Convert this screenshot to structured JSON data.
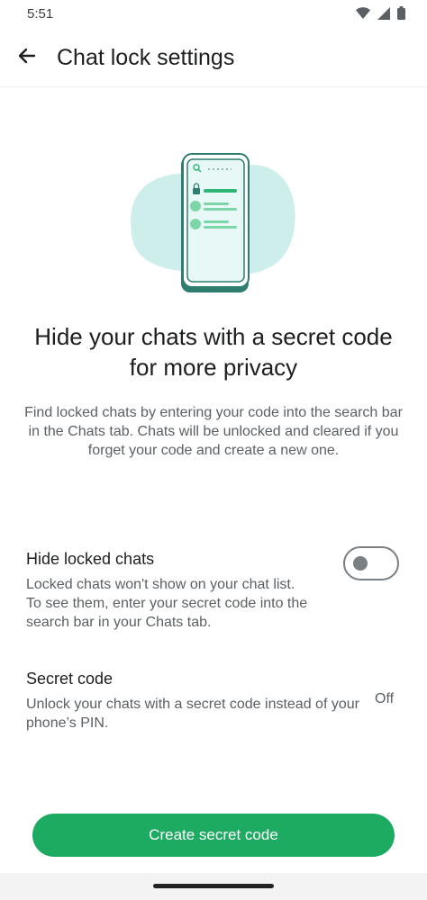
{
  "status_bar": {
    "time": "5:51",
    "icons": [
      "wifi-icon",
      "signal-icon",
      "battery-icon"
    ]
  },
  "app_bar": {
    "back_icon": "arrow-left-icon",
    "title": "Chat lock settings"
  },
  "illustration": {
    "icons": [
      "search-icon",
      "lock-icon"
    ]
  },
  "intro": {
    "headline": "Hide your chats with a secret code for more privacy",
    "description": "Find locked chats by entering your code into the search bar in the Chats tab. Chats will be unlocked and cleared if you forget your code and create a new one."
  },
  "settings": {
    "hide_locked": {
      "title": "Hide locked chats",
      "description": "Locked chats won't show on your chat list. To see them, enter your secret code into the search bar in your Chats tab.",
      "enabled": false
    },
    "secret_code": {
      "title": "Secret code",
      "description": "Unlock your chats with a secret code instead of your phone’s PIN.",
      "value": "Off"
    }
  },
  "primary_button": {
    "label": "Create secret code"
  },
  "colors": {
    "accent": "#1daa61",
    "illustration_bg": "#cdeeea",
    "phone_outline": "#2e7d6e"
  }
}
